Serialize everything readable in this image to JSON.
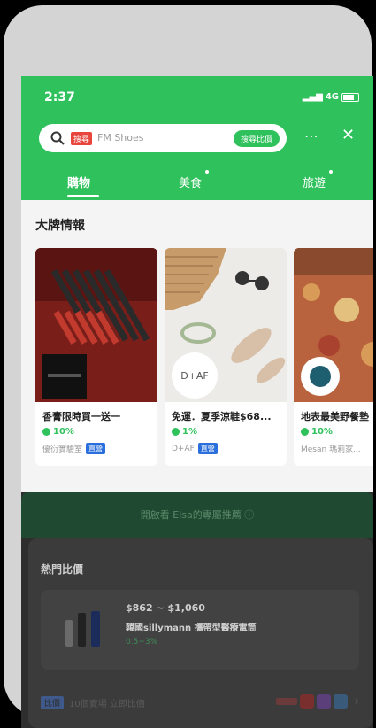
{
  "status_bar": {
    "time": "2:37",
    "network": "4G"
  },
  "search": {
    "tag": "搜尋",
    "placeholder": "FM Shoes",
    "compare_label": "搜尋比價"
  },
  "tabs": [
    {
      "label": "購物"
    },
    {
      "label": "美食"
    },
    {
      "label": "旅遊"
    }
  ],
  "section_title": "大牌情報",
  "cards": [
    {
      "title": "香膏限時買一送一",
      "cashback": "10%",
      "store": "優衍實驗室",
      "badge": "直營"
    },
    {
      "title": "免運．夏季涼鞋$68...",
      "logo": "D+AF",
      "cashback": "1%",
      "store": "D+AF",
      "badge": "直營"
    },
    {
      "title": "地表最美野餐墊",
      "cashback": "10%",
      "store": "Mesan 瑪莉家..."
    }
  ],
  "banner_text": "開啟看 Elsa的專屬推薦 ⓘ",
  "hot_section": {
    "title": "熱門比價",
    "product": {
      "price": "$862 ~ $1,060",
      "name": "韓國sillymann 攜帶型醫療電筒",
      "pct": "0.5~3%"
    },
    "footer_tag": "比價",
    "footer_text": "10個賣場 立即比價"
  },
  "colors": {
    "accent": "#2fc15c",
    "badge_blue": "#2a6fdb",
    "search_tag": "#e8453c"
  }
}
